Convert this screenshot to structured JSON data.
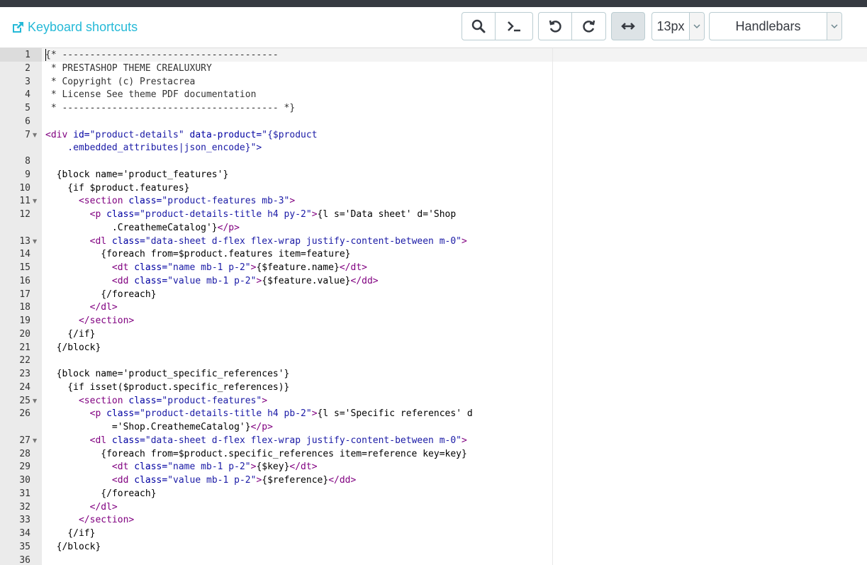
{
  "toolbar": {
    "shortcuts_link": "Keyboard shortcuts",
    "buttons": [
      {
        "name": "search-button",
        "icon": "search-icon"
      },
      {
        "name": "command-button",
        "icon": "terminal-icon"
      },
      {
        "name": "undo-button",
        "icon": "undo-icon"
      },
      {
        "name": "redo-button",
        "icon": "redo-icon"
      },
      {
        "name": "wrap-button",
        "icon": "arrows-horizontal-icon"
      }
    ],
    "font_size": "13px",
    "language": "Handlebars"
  },
  "editor": {
    "lines": [
      {
        "n": "1",
        "code": "{* ---------------------------------------",
        "cls": "c-cm"
      },
      {
        "n": "2",
        "code": " * PRESTASHOP THEME CREALUXURY",
        "cls": "c-cm"
      },
      {
        "n": "3",
        "code": " * Copyright (c) Prestacrea",
        "cls": "c-cm"
      },
      {
        "n": "4",
        "code": " * License See theme PDF documentation",
        "cls": "c-cm"
      },
      {
        "n": "5",
        "code": " * --------------------------------------- *}",
        "cls": "c-cm"
      },
      {
        "n": "6",
        "code": ""
      },
      {
        "n": "7",
        "fold": true,
        "segs": [
          [
            "<div ",
            "c-tag"
          ],
          [
            "id=",
            "c-attr"
          ],
          [
            "\"product-details\" ",
            "c-str"
          ],
          [
            "data-product=",
            "c-attr"
          ],
          [
            "\"{$product",
            "c-str"
          ]
        ]
      },
      {
        "n": "",
        "segs": [
          [
            "    .embedded_attributes|json_encode}\">",
            "c-str"
          ]
        ]
      },
      {
        "n": "8",
        "code": ""
      },
      {
        "n": "9",
        "code": "  {block name='product_features'}"
      },
      {
        "n": "10",
        "code": "    {if $product.features}"
      },
      {
        "n": "11",
        "fold": true,
        "segs": [
          [
            "      <section ",
            "c-tag"
          ],
          [
            "class=",
            "c-attr"
          ],
          [
            "\"product-features mb-3\"",
            "c-str"
          ],
          [
            ">",
            "c-tag"
          ]
        ]
      },
      {
        "n": "12",
        "segs": [
          [
            "        <p ",
            "c-tag"
          ],
          [
            "class=",
            "c-attr"
          ],
          [
            "\"product-details-title h4 py-2\"",
            "c-str"
          ],
          [
            ">",
            "c-tag"
          ],
          [
            "{l s='Data sheet' d='Shop",
            ""
          ]
        ]
      },
      {
        "n": "",
        "segs": [
          [
            "            .CreathemeCatalog'}",
            ""
          ],
          [
            "</p>",
            "c-tag"
          ]
        ]
      },
      {
        "n": "13",
        "fold": true,
        "segs": [
          [
            "        <dl ",
            "c-tag"
          ],
          [
            "class=",
            "c-attr"
          ],
          [
            "\"data-sheet d-flex flex-wrap justify-content-between m-0\"",
            "c-str"
          ],
          [
            ">",
            "c-tag"
          ]
        ]
      },
      {
        "n": "14",
        "code": "          {foreach from=$product.features item=feature}"
      },
      {
        "n": "15",
        "segs": [
          [
            "            <dt ",
            "c-tag"
          ],
          [
            "class=",
            "c-attr"
          ],
          [
            "\"name mb-1 p-2\"",
            "c-str"
          ],
          [
            ">",
            "c-tag"
          ],
          [
            "{$feature.name}",
            ""
          ],
          [
            "</dt>",
            "c-tag"
          ]
        ]
      },
      {
        "n": "16",
        "segs": [
          [
            "            <dd ",
            "c-tag"
          ],
          [
            "class=",
            "c-attr"
          ],
          [
            "\"value mb-1 p-2\"",
            "c-str"
          ],
          [
            ">",
            "c-tag"
          ],
          [
            "{$feature.value}",
            ""
          ],
          [
            "</dd>",
            "c-tag"
          ]
        ]
      },
      {
        "n": "17",
        "code": "          {/foreach}"
      },
      {
        "n": "18",
        "segs": [
          [
            "        </dl>",
            "c-tag"
          ]
        ]
      },
      {
        "n": "19",
        "segs": [
          [
            "      </section>",
            "c-tag"
          ]
        ]
      },
      {
        "n": "20",
        "code": "    {/if}"
      },
      {
        "n": "21",
        "code": "  {/block}"
      },
      {
        "n": "22",
        "code": ""
      },
      {
        "n": "23",
        "code": "  {block name='product_specific_references'}"
      },
      {
        "n": "24",
        "code": "    {if isset($product.specific_references)}"
      },
      {
        "n": "25",
        "fold": true,
        "segs": [
          [
            "      <section ",
            "c-tag"
          ],
          [
            "class=",
            "c-attr"
          ],
          [
            "\"product-features\"",
            "c-str"
          ],
          [
            ">",
            "c-tag"
          ]
        ]
      },
      {
        "n": "26",
        "segs": [
          [
            "        <p ",
            "c-tag"
          ],
          [
            "class=",
            "c-attr"
          ],
          [
            "\"product-details-title h4 pb-2\"",
            "c-str"
          ],
          [
            ">",
            "c-tag"
          ],
          [
            "{l s='Specific references' d",
            ""
          ]
        ]
      },
      {
        "n": "",
        "segs": [
          [
            "            ='Shop.CreathemeCatalog'}",
            ""
          ],
          [
            "</p>",
            "c-tag"
          ]
        ]
      },
      {
        "n": "27",
        "fold": true,
        "segs": [
          [
            "        <dl ",
            "c-tag"
          ],
          [
            "class=",
            "c-attr"
          ],
          [
            "\"data-sheet d-flex flex-wrap justify-content-between m-0\"",
            "c-str"
          ],
          [
            ">",
            "c-tag"
          ]
        ]
      },
      {
        "n": "28",
        "code": "          {foreach from=$product.specific_references item=reference key=key}"
      },
      {
        "n": "29",
        "segs": [
          [
            "            <dt ",
            "c-tag"
          ],
          [
            "class=",
            "c-attr"
          ],
          [
            "\"name mb-1 p-2\"",
            "c-str"
          ],
          [
            ">",
            "c-tag"
          ],
          [
            "{$key}",
            ""
          ],
          [
            "</dt>",
            "c-tag"
          ]
        ]
      },
      {
        "n": "30",
        "segs": [
          [
            "            <dd ",
            "c-tag"
          ],
          [
            "class=",
            "c-attr"
          ],
          [
            "\"value mb-1 p-2\"",
            "c-str"
          ],
          [
            ">",
            "c-tag"
          ],
          [
            "{$reference}",
            ""
          ],
          [
            "</dd>",
            "c-tag"
          ]
        ]
      },
      {
        "n": "31",
        "code": "          {/foreach}"
      },
      {
        "n": "32",
        "segs": [
          [
            "        </dl>",
            "c-tag"
          ]
        ]
      },
      {
        "n": "33",
        "segs": [
          [
            "      </section>",
            "c-tag"
          ]
        ]
      },
      {
        "n": "34",
        "code": "    {/if}"
      },
      {
        "n": "35",
        "code": "  {/block}"
      },
      {
        "n": "36",
        "code": ""
      }
    ]
  }
}
